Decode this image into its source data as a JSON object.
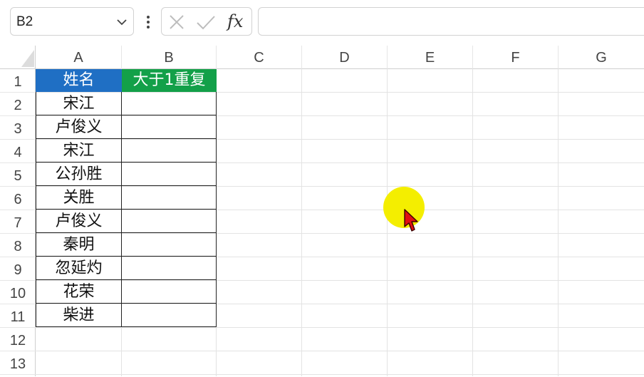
{
  "formula_bar": {
    "name_box": "B2",
    "cancel_icon": "close-icon",
    "enter_icon": "check-icon",
    "fx_label": "fx",
    "formula_value": ""
  },
  "grid": {
    "columns": [
      "A",
      "B",
      "C",
      "D",
      "E",
      "F",
      "G"
    ],
    "rows": [
      "1",
      "2",
      "3",
      "4",
      "5",
      "6",
      "7",
      "8",
      "9",
      "10",
      "11",
      "12",
      "13"
    ],
    "cells": {
      "A1": "姓名",
      "B1": "大于1重复",
      "A2": "宋江",
      "A3": "卢俊义",
      "A4": "宋江",
      "A5": "公孙胜",
      "A6": "关胜",
      "A7": "卢俊义",
      "A8": "秦明",
      "A9": "忽延灼",
      "A10": "花荣",
      "A11": "柴进"
    }
  },
  "colors": {
    "header_a_bg": "#1f6fc4",
    "header_b_bg": "#13a049",
    "cursor_highlight": "#f4ee00",
    "cursor_color": "#e01010"
  }
}
